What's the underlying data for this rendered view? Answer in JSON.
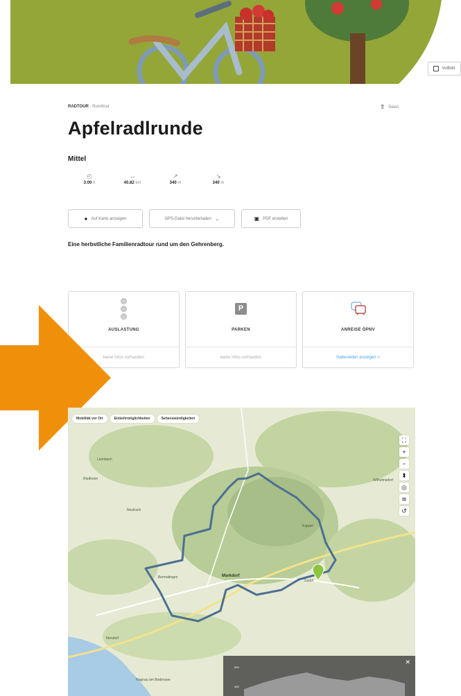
{
  "hero": {
    "fullscreen_label": "Vollbild"
  },
  "tour": {
    "type": "RADTOUR",
    "subtype": " - Rundtour",
    "title": "Apfelradlrunde",
    "difficulty": "Mittel",
    "share_label": "Teilen",
    "tagline": "Eine herbstliche Familienradtour rund um den Gehrenberg."
  },
  "stats": [
    {
      "icon": "clock-icon",
      "value": "3:00",
      "unit": "h"
    },
    {
      "icon": "distance-icon",
      "value": "40.82",
      "unit": "km"
    },
    {
      "icon": "ascent-icon",
      "value": "340",
      "unit": "m"
    },
    {
      "icon": "descent-icon",
      "value": "340",
      "unit": "m"
    }
  ],
  "actions": {
    "map": "Auf Karte anzeigen",
    "gps": "GPS-Datei herunterladen",
    "pdf": "PDF erstellen"
  },
  "cards": [
    {
      "title": "AUSLASTUNG",
      "footer": "keine Infos vorhanden"
    },
    {
      "title": "PARKEN",
      "footer": "keine Infos vorhanden"
    },
    {
      "title": "ANREISE ÖPNV",
      "footer": "Haltestellen anzeigen >"
    }
  ],
  "map": {
    "chips": [
      "Mobilität vor Ort",
      "Einkehrmöglichkeiten",
      "Sehenswürdigkeiten"
    ],
    "places": {
      "markdorf": "Markdorf",
      "bermatingen": "Bermatingen",
      "neufrach": "Neufrach",
      "kappel": "Kappel",
      "ittendorf": "Ittendorf",
      "hagnau": "Hagnau am Bodensee",
      "leimbach": "Leimbach",
      "wilhelmsdorf": "Wilhelmsdorf",
      "riedheim": "Riedheim",
      "stadel": "Stadel"
    },
    "profile": {
      "y_top": "600",
      "y_bottom": "400"
    }
  },
  "colors": {
    "accent": "#f0900a",
    "route": "#4b6f92",
    "link": "#4aa3df",
    "hero_green": "#93a637"
  }
}
